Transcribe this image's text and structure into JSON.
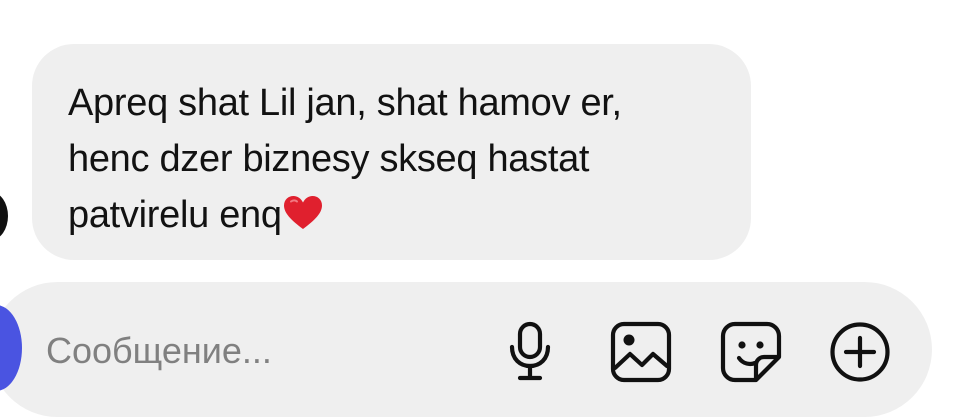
{
  "chat": {
    "message_lines": [
      "Apreq shat Lil jan, shat hamov er,",
      "henc dzer biznesy skseq hastat",
      "patvirelu enq"
    ],
    "emoji": "❤️"
  },
  "composer": {
    "placeholder": "Сообщение..."
  },
  "icons": {
    "microphone": "microphone-icon",
    "gallery": "image-icon",
    "sticker": "sticker-icon",
    "add": "plus-circle-icon"
  },
  "colors": {
    "bubble": "#efefef",
    "text": "#121212",
    "placeholder": "#808080",
    "send_accent": "#4a54e1",
    "heart": "#e0202e"
  }
}
